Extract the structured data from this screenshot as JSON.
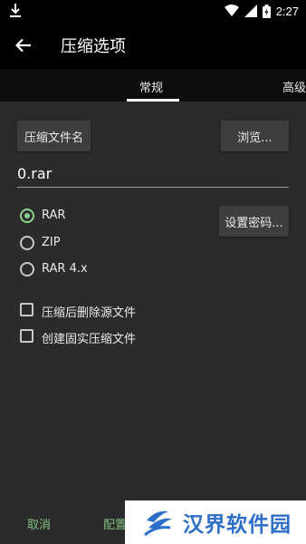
{
  "statusbar": {
    "time": "2:27"
  },
  "appbar": {
    "title": "压缩选项"
  },
  "tabs": [
    {
      "label": "常规",
      "active": true
    },
    {
      "label": "高级",
      "active": false
    }
  ],
  "general": {
    "archive_name_button": "压缩文件名",
    "browse_button": "浏览...",
    "filename_value": "0.rar",
    "set_password_button": "设置密码...",
    "formats": [
      {
        "label": "RAR",
        "selected": true
      },
      {
        "label": "ZIP",
        "selected": false
      },
      {
        "label": "RAR 4.x",
        "selected": false
      }
    ],
    "options": [
      {
        "label": "压缩后删除源文件",
        "checked": false
      },
      {
        "label": "创建固实压缩文件",
        "checked": false
      }
    ]
  },
  "bottombar": {
    "cancel": "取消",
    "profiles": "配置"
  },
  "watermark": {
    "text": "汉界软件园"
  },
  "colors": {
    "accent": "#8fd08f",
    "bottom_button": "#7fbf7f",
    "watermark_text": "#2d6ec8"
  }
}
